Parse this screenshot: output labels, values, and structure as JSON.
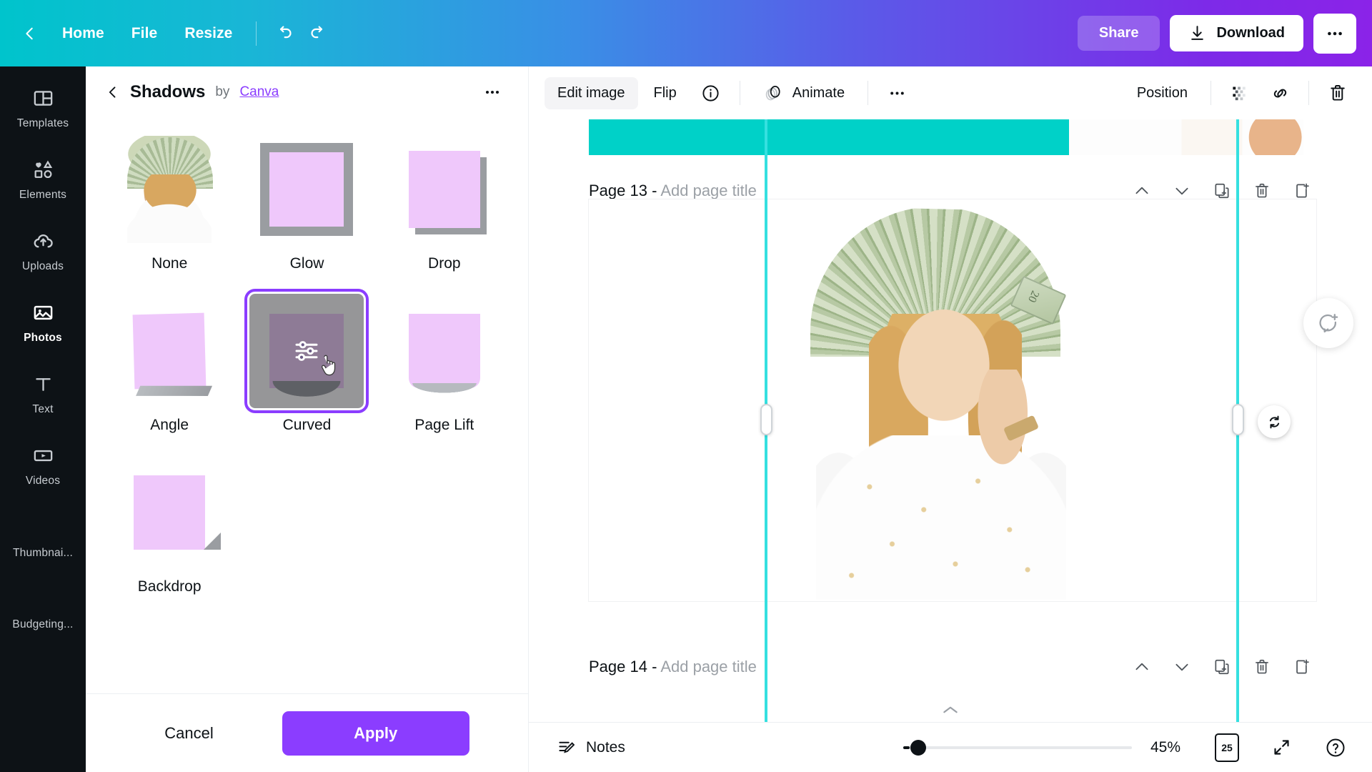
{
  "topbar": {
    "back_icon": "chevron-left-icon",
    "home": "Home",
    "file": "File",
    "resize": "Resize",
    "undo_icon": "undo-icon",
    "redo_icon": "redo-icon",
    "share": "Share",
    "download": "Download",
    "download_icon": "download-icon",
    "more_icon": "more-horizontal-icon"
  },
  "rail": {
    "items": [
      {
        "label": "Templates",
        "icon": "templates-icon",
        "active": false
      },
      {
        "label": "Elements",
        "icon": "elements-icon",
        "active": false
      },
      {
        "label": "Uploads",
        "icon": "cloud-upload-icon",
        "active": false
      },
      {
        "label": "Photos",
        "icon": "photos-icon",
        "active": true
      },
      {
        "label": "Text",
        "icon": "text-icon",
        "active": false
      },
      {
        "label": "Videos",
        "icon": "videos-icon",
        "active": false
      },
      {
        "label": "Thumbnai...",
        "icon": "thumbnail-preview-icon",
        "active": false
      },
      {
        "label": "Budgeting...",
        "icon": "budgeting-preview-icon",
        "active": false
      }
    ]
  },
  "panel": {
    "back_icon": "chevron-left-icon",
    "title": "Shadows",
    "by_text": "by",
    "author": "Canva",
    "more_icon": "more-horizontal-icon",
    "shadows": [
      {
        "label": "None",
        "id": "none",
        "selected": false
      },
      {
        "label": "Glow",
        "id": "glow",
        "selected": false
      },
      {
        "label": "Drop",
        "id": "drop",
        "selected": false
      },
      {
        "label": "Angle",
        "id": "angle",
        "selected": false
      },
      {
        "label": "Curved",
        "id": "curved",
        "selected": true
      },
      {
        "label": "Page Lift",
        "id": "page-lift",
        "selected": false
      },
      {
        "label": "Backdrop",
        "id": "backdrop",
        "selected": false
      }
    ],
    "cancel": "Cancel",
    "apply": "Apply"
  },
  "context_bar": {
    "edit_image": "Edit image",
    "flip": "Flip",
    "info_icon": "info-circle-icon",
    "animate": "Animate",
    "animate_icon": "animate-icon",
    "more_icon": "more-horizontal-icon",
    "position": "Position",
    "transparency_icon": "transparency-icon",
    "link_icon": "link-icon",
    "delete_icon": "trash-icon"
  },
  "canvas": {
    "pages": [
      {
        "title_prefix": "Page 13",
        "separator": "-",
        "title_placeholder": "Add page title",
        "actions": [
          "move-up-icon",
          "move-down-icon",
          "duplicate-page-icon",
          "delete-page-icon",
          "add-page-icon"
        ]
      },
      {
        "title_prefix": "Page 14",
        "separator": "-",
        "title_placeholder": "Add page title",
        "actions": [
          "move-up-icon",
          "move-down-icon",
          "duplicate-page-icon",
          "delete-page-icon",
          "add-page-icon"
        ]
      }
    ],
    "comment_icon": "add-comment-icon",
    "rotate_icon": "rotate-icon",
    "scroll_up_icon": "chevron-up-icon"
  },
  "bottombar": {
    "notes": "Notes",
    "notes_icon": "notes-icon",
    "zoom_percent": "45%",
    "zoom_value": 45,
    "page_count": "25",
    "grid_icon": "page-manager-icon",
    "fullscreen_icon": "expand-icon",
    "help_icon": "help-circle-icon"
  },
  "colors": {
    "brand_purple": "#8b3dff",
    "teal": "#00c4cc",
    "guide_cyan": "#35e0e0",
    "shadow_preview_fill": "#efc8fb",
    "shadow_preview_shadow": "#9a9da1",
    "rail_bg": "#0d1216"
  }
}
